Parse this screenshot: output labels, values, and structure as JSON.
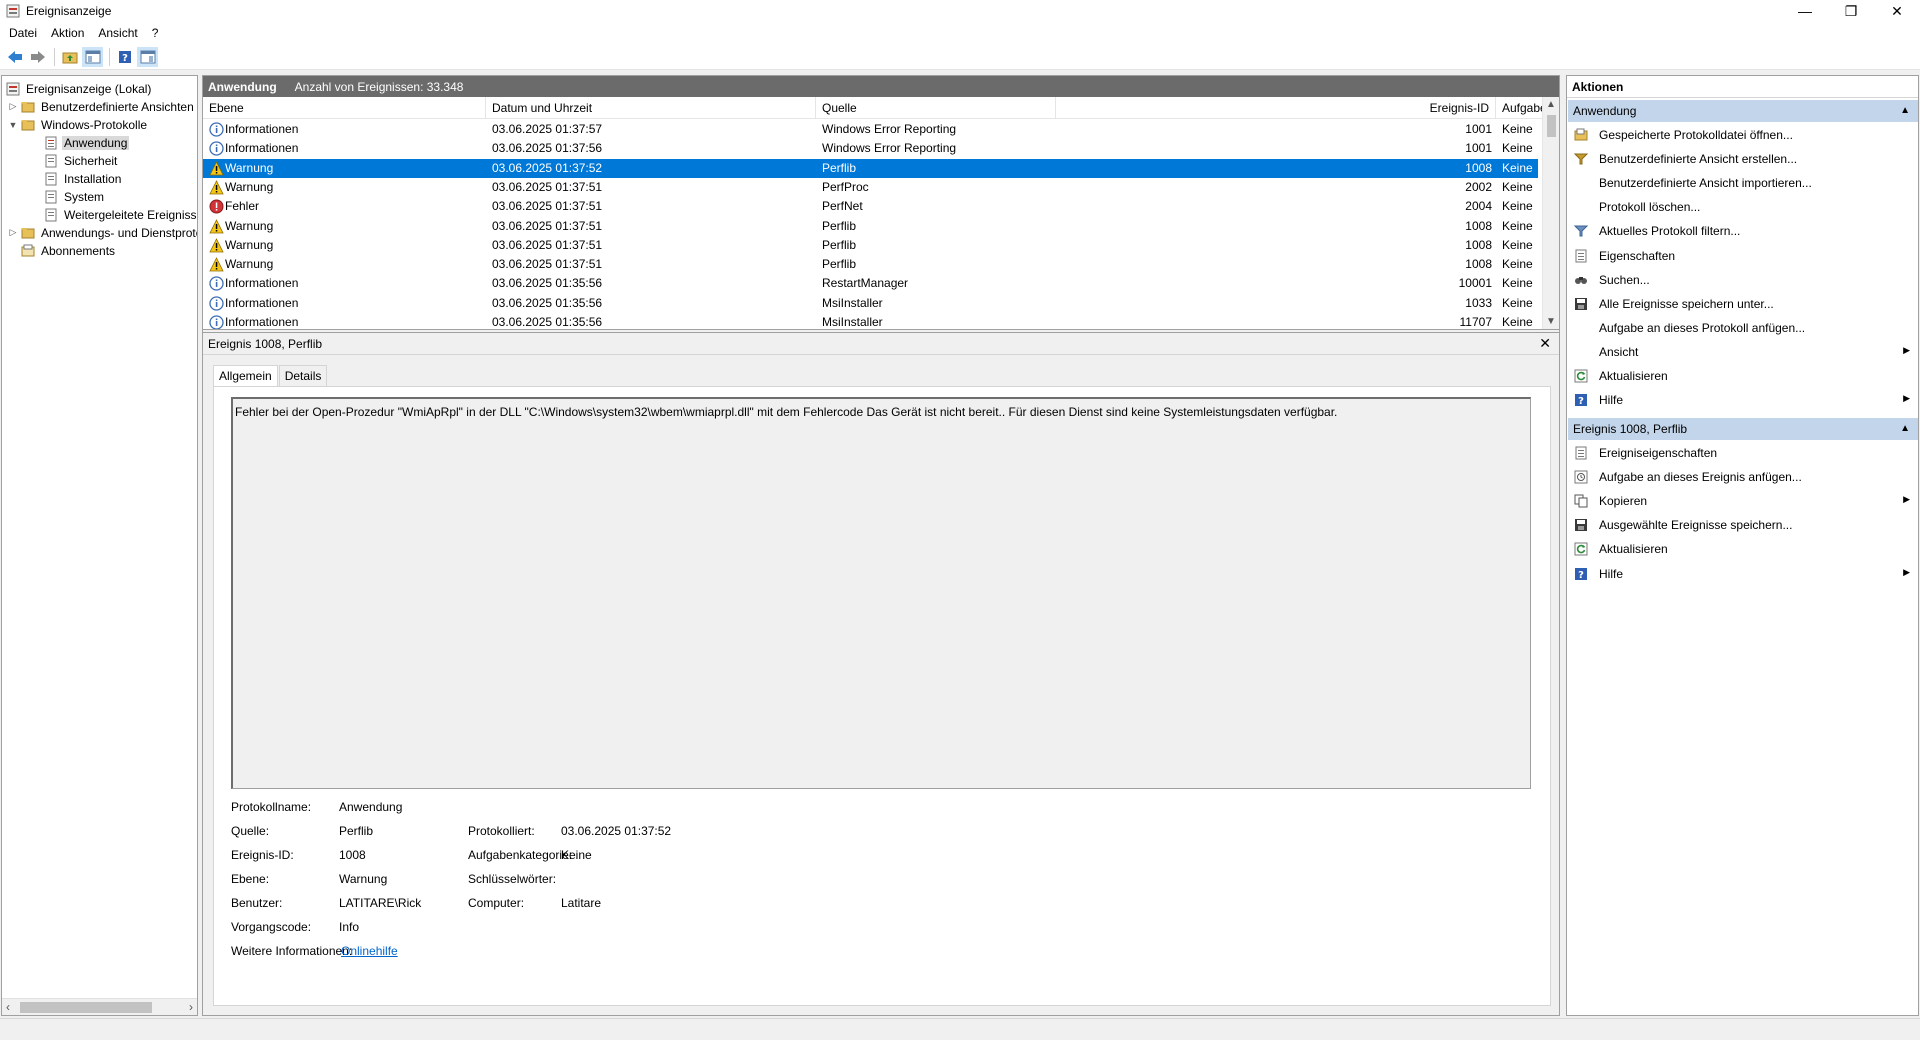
{
  "window": {
    "title": "Ereignisanzeige",
    "controls": {
      "minimize": "—",
      "restore": "❐",
      "close": "✕"
    }
  },
  "menu": [
    "Datei",
    "Aktion",
    "Ansicht",
    "?"
  ],
  "tree": {
    "items": [
      {
        "label": "Ereignisanzeige (Lokal)",
        "icon": "event-viewer-icon"
      },
      {
        "label": "Benutzerdefinierte Ansichten",
        "icon": "folder-icon"
      },
      {
        "label": "Windows-Protokolle",
        "icon": "folder-icon"
      },
      {
        "label": "Anwendung",
        "icon": "log-icon"
      },
      {
        "label": "Sicherheit",
        "icon": "log-icon"
      },
      {
        "label": "Installation",
        "icon": "log-icon"
      },
      {
        "label": "System",
        "icon": "log-icon"
      },
      {
        "label": "Weitergeleitete Ereignisse",
        "icon": "log-icon"
      },
      {
        "label": "Anwendungs- und Dienstprotokolle",
        "icon": "folder-icon"
      },
      {
        "label": "Abonnements",
        "icon": "subscription-icon"
      }
    ]
  },
  "log": {
    "name": "Anwendung",
    "count_text": "Anzahl von Ereignissen: 33.348",
    "columns": [
      "Ebene",
      "Datum und Uhrzeit",
      "Quelle",
      "Ereignis-ID",
      "Aufgabenkategorie"
    ],
    "rows": [
      {
        "level": "Informationen",
        "icon": "info",
        "date": "03.06.2025 01:37:57",
        "source": "Windows Error Reporting",
        "id": "1001",
        "cat": "Keine"
      },
      {
        "level": "Informationen",
        "icon": "info",
        "date": "03.06.2025 01:37:56",
        "source": "Windows Error Reporting",
        "id": "1001",
        "cat": "Keine"
      },
      {
        "level": "Warnung",
        "icon": "warning",
        "date": "03.06.2025 01:37:52",
        "source": "Perflib",
        "id": "1008",
        "cat": "Keine",
        "selected": true
      },
      {
        "level": "Warnung",
        "icon": "warning",
        "date": "03.06.2025 01:37:51",
        "source": "PerfProc",
        "id": "2002",
        "cat": "Keine"
      },
      {
        "level": "Fehler",
        "icon": "error",
        "date": "03.06.2025 01:37:51",
        "source": "PerfNet",
        "id": "2004",
        "cat": "Keine"
      },
      {
        "level": "Warnung",
        "icon": "warning",
        "date": "03.06.2025 01:37:51",
        "source": "Perflib",
        "id": "1008",
        "cat": "Keine"
      },
      {
        "level": "Warnung",
        "icon": "warning",
        "date": "03.06.2025 01:37:51",
        "source": "Perflib",
        "id": "1008",
        "cat": "Keine"
      },
      {
        "level": "Warnung",
        "icon": "warning",
        "date": "03.06.2025 01:37:51",
        "source": "Perflib",
        "id": "1008",
        "cat": "Keine"
      },
      {
        "level": "Informationen",
        "icon": "info",
        "date": "03.06.2025 01:35:56",
        "source": "RestartManager",
        "id": "10001",
        "cat": "Keine"
      },
      {
        "level": "Informationen",
        "icon": "info",
        "date": "03.06.2025 01:35:56",
        "source": "MsiInstaller",
        "id": "1033",
        "cat": "Keine"
      },
      {
        "level": "Informationen",
        "icon": "info",
        "date": "03.06.2025 01:35:56",
        "source": "MsiInstaller",
        "id": "11707",
        "cat": "Keine"
      }
    ]
  },
  "detail": {
    "title": "Ereignis 1008, Perflib",
    "tabs": [
      "Allgemein",
      "Details"
    ],
    "message": "Fehler bei der Open-Prozedur \"WmiApRpl\" in der DLL \"C:\\Windows\\system32\\wbem\\wmiaprpl.dll\" mit dem Fehlercode Das Gerät ist nicht bereit.. Für diesen Dienst sind keine Systemleistungsdaten verfügbar.",
    "props": {
      "protokollname_label": "Protokollname:",
      "protokollname": "Anwendung",
      "quelle_label": "Quelle:",
      "quelle": "Perflib",
      "protokolliert_label": "Protokolliert:",
      "protokolliert": "03.06.2025 01:37:52",
      "ereignis_id_label": "Ereignis-ID:",
      "ereignis_id": "1008",
      "aufgabenkategorie_label": "Aufgabenkategorie:",
      "aufgabenkategorie": "Keine",
      "ebene_label": "Ebene:",
      "ebene": "Warnung",
      "schluesselwoerter_label": "Schlüsselwörter:",
      "schluesselwoerter": "",
      "benutzer_label": "Benutzer:",
      "benutzer": "LATITARE\\Rick",
      "computer_label": "Computer:",
      "computer": "Latitare",
      "vorgangscode_label": "Vorgangscode:",
      "vorgangscode": "Info",
      "weitere_label": "Weitere Informationen:",
      "weitere_link": "Onlinehilfe"
    }
  },
  "actions": {
    "title": "Aktionen",
    "section1": {
      "title": "Anwendung",
      "items": [
        {
          "label": "Gespeicherte Protokolldatei öffnen...",
          "icon": "open-log-icon"
        },
        {
          "label": "Benutzerdefinierte Ansicht erstellen...",
          "icon": "filter-create-icon"
        },
        {
          "label": "Benutzerdefinierte Ansicht importieren...",
          "icon": ""
        },
        {
          "label": "Protokoll löschen...",
          "icon": ""
        },
        {
          "label": "Aktuelles Protokoll filtern...",
          "icon": "filter-icon"
        },
        {
          "label": "Eigenschaften",
          "icon": "properties-icon"
        },
        {
          "label": "Suchen...",
          "icon": "find-icon"
        },
        {
          "label": "Alle Ereignisse speichern unter...",
          "icon": "save-icon"
        },
        {
          "label": "Aufgabe an dieses Protokoll anfügen...",
          "icon": ""
        },
        {
          "label": "Ansicht",
          "icon": "",
          "submenu": true
        },
        {
          "label": "Aktualisieren",
          "icon": "refresh-icon"
        },
        {
          "label": "Hilfe",
          "icon": "help-icon",
          "submenu": true
        }
      ]
    },
    "section2": {
      "title": "Ereignis 1008, Perflib",
      "items": [
        {
          "label": "Ereigniseigenschaften",
          "icon": "properties-icon"
        },
        {
          "label": "Aufgabe an dieses Ereignis anfügen...",
          "icon": "task-icon"
        },
        {
          "label": "Kopieren",
          "icon": "copy-icon",
          "submenu": true
        },
        {
          "label": "Ausgewählte Ereignisse speichern...",
          "icon": "save-icon"
        },
        {
          "label": "Aktualisieren",
          "icon": "refresh-icon"
        },
        {
          "label": "Hilfe",
          "icon": "help-icon",
          "submenu": true
        }
      ]
    }
  },
  "colors": {
    "selection": "#0078d7",
    "section_header": "#c3d5ea",
    "list_header": "#6b6b6b",
    "link": "#0066cc"
  }
}
